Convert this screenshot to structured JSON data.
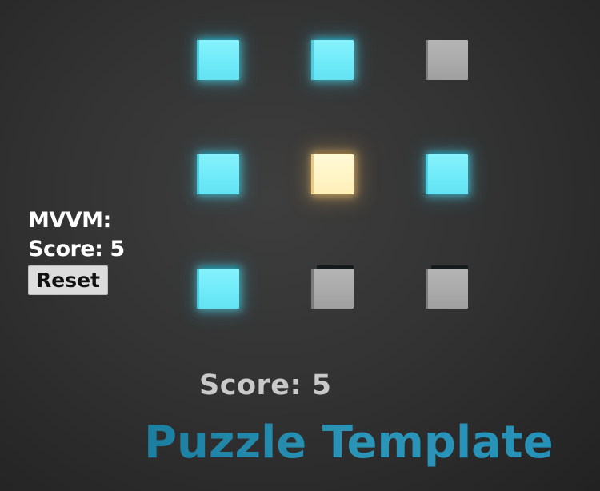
{
  "game": {
    "title": "Puzzle Template",
    "score_text": "Score: 5",
    "grid": [
      [
        "cyan",
        "cyan",
        "gray"
      ],
      [
        "cyan",
        "yellow",
        "cyan"
      ],
      [
        "cyan",
        "gray",
        "gray"
      ]
    ]
  },
  "mvvm_panel": {
    "heading": "MVVM:",
    "score_text": "Score: 5",
    "reset_label": "Reset"
  },
  "colors": {
    "active_block": "#6eeaf8",
    "selected_block": "#fff4c6",
    "inactive_block": "#a9a9a9",
    "title": "#1e88a8",
    "score_text": "#c9c9c9"
  }
}
